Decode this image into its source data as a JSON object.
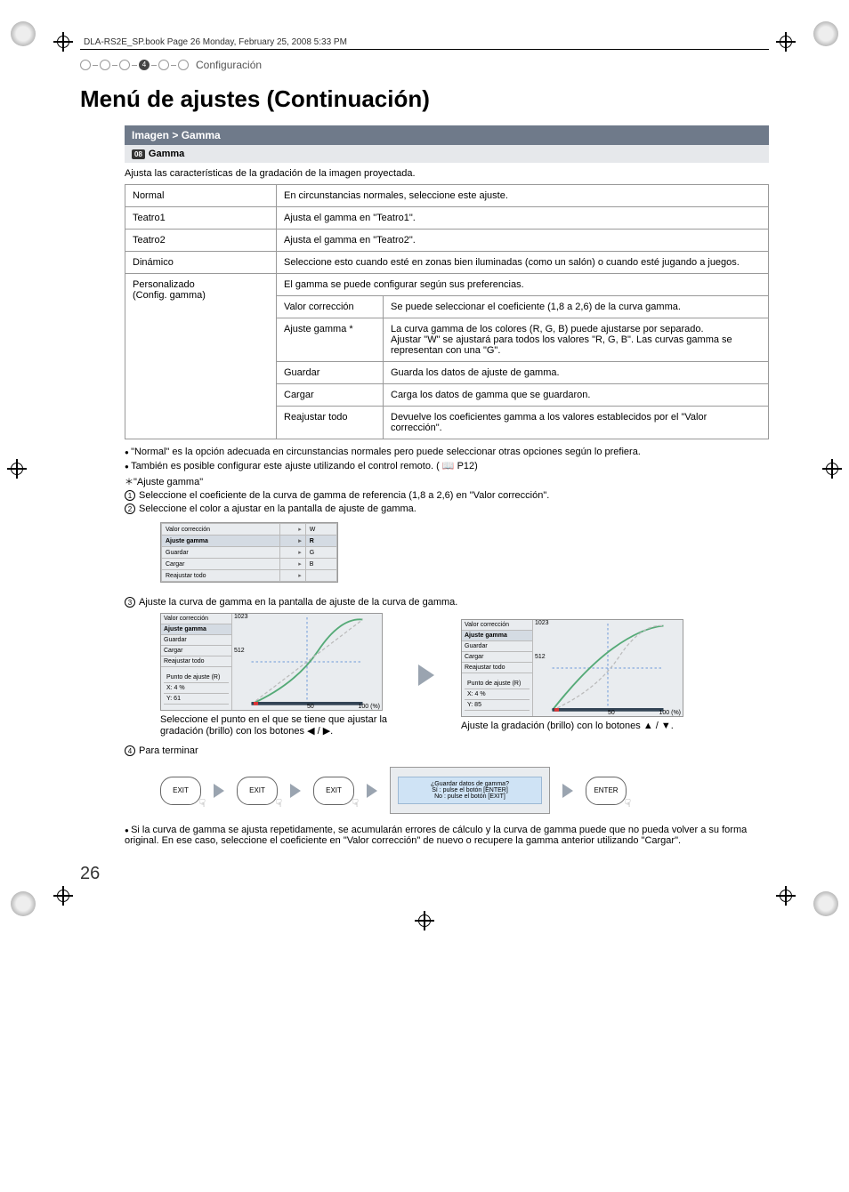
{
  "meta": {
    "header": "DLA-RS2E_SP.book  Page 26  Monday, February 25, 2008  5:33 PM",
    "section_num": "4",
    "breadcrumb": "Configuración",
    "title": "Menú de ajustes (Continuación)",
    "page_number": "26"
  },
  "section": {
    "bar": "Imagen > Gamma",
    "badge": "08",
    "sub": "Gamma",
    "intro": "Ajusta las características de la gradación de la imagen proyectada."
  },
  "table": {
    "rows": [
      {
        "label": "Normal",
        "desc": "En circunstancias normales, seleccione este ajuste."
      },
      {
        "label": "Teatro1",
        "desc": "Ajusta el gamma en \"Teatro1\"."
      },
      {
        "label": "Teatro2",
        "desc": "Ajusta el gamma en \"Teatro2\"."
      },
      {
        "label": "Dinámico",
        "desc": "Seleccione esto cuando esté en zonas bien iluminadas (como un salón) o cuando esté jugando a juegos."
      }
    ],
    "custom": {
      "label1": "Personalizado",
      "label2": "(Config. gamma)",
      "desc": "El gamma se puede configurar según sus preferencias.",
      "subrows": [
        {
          "label": "Valor corrección",
          "desc": "Se puede seleccionar el coeficiente (1,8 a 2,6) de la curva gamma."
        },
        {
          "label": "Ajuste gamma *",
          "desc": "La curva gamma de los colores (R, G, B) puede ajustarse por separado.\nAjustar \"W\" se ajustará para todos los valores \"R, G, B\". Las curvas gamma se representan con una \"G\"."
        },
        {
          "label": "Guardar",
          "desc": "Guarda los datos de ajuste de gamma."
        },
        {
          "label": "Cargar",
          "desc": "Carga los datos de gamma que se guardaron."
        },
        {
          "label": "Reajustar todo",
          "desc": "Devuelve los coeficientes gamma a los valores establecidos por el \"Valor corrección\"."
        }
      ]
    }
  },
  "notes": {
    "n1": "\"Normal\" es la opción adecuada en circunstancias normales pero puede seleccionar otras opciones según lo prefiera.",
    "n2": "También es posible configurar este ajuste utilizando el control remoto. (",
    "n2ref": "P12",
    "n2end": ")",
    "star_title": "\"Ajuste gamma\"",
    "s1": "Seleccione el coeficiente de la curva de gamma de referencia (1,8 a 2,6) en \"Valor corrección\".",
    "s2": "Seleccione el color a ajustar en la pantalla de ajuste de gamma.",
    "s3": "Ajuste la curva de gamma en la pantalla de ajuste de la curva de gamma.",
    "cap_left": "Seleccione el punto en el que se tiene que ajustar la gradación (brillo) con los botones ◀ / ▶.",
    "cap_right": "Ajuste la gradación (brillo) con lo botones ▲ / ▼.",
    "s4": "Para terminar",
    "final": "Si la curva de gamma se ajusta repetidamente, se acumularán errores de cálculo y la curva de gamma puede que no pueda volver a su forma original. En ese caso, seleccione el coeficiente en \"Valor corrección\" de nuevo o recupere la gamma anterior utilizando \"Cargar\"."
  },
  "mock_menu": {
    "items": [
      "Valor corrección",
      "Ajuste gamma",
      "Guardar",
      "Cargar",
      "Reajustar todo"
    ],
    "colors": [
      "W",
      "R",
      "G",
      "B"
    ],
    "point_label": "Punto de ajuste (R)",
    "point_x": "X:     4 %",
    "point_y1": "Y:    61",
    "point_y2": "Y:    85",
    "axis": {
      "y_top": "1023",
      "y_mid": "512",
      "x_mid": "50",
      "x_end": "100 (%)"
    }
  },
  "buttons": {
    "exit": "EXIT",
    "enter": "ENTER"
  },
  "dialog": {
    "title": "¿Guardar datos de gamma?",
    "line1": "Sí : pulse el botón [ENTER]",
    "line2": "No : pulse el botón [EXIT]"
  }
}
